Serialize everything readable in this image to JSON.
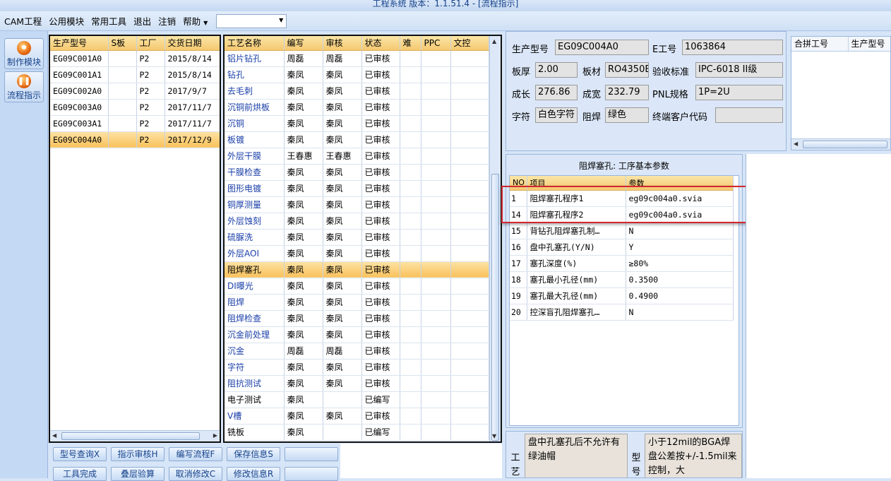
{
  "window": {
    "title": "工程系统  版本：1.1.51.4 - [流程指示]"
  },
  "menu": {
    "items": [
      "CAM工程",
      "公用模块",
      "常用工具",
      "退出",
      "注销",
      "帮助"
    ],
    "combo_value": ""
  },
  "nav": [
    {
      "label": "制作模块",
      "icon": "fire-icon"
    },
    {
      "label": "流程指示",
      "icon": "pause-icon"
    }
  ],
  "models": {
    "headers": [
      "生产型号",
      "S板",
      "工厂",
      "交货日期"
    ],
    "rows": [
      [
        "EG09C001A0",
        "",
        "P2",
        "2015/8/14"
      ],
      [
        "EG09C001A1",
        "",
        "P2",
        "2015/8/14"
      ],
      [
        "EG09C002A0",
        "",
        "P2",
        "2017/9/7"
      ],
      [
        "EG09C003A0",
        "",
        "P2",
        "2017/11/7"
      ],
      [
        "EG09C003A1",
        "",
        "P2",
        "2017/11/7"
      ],
      [
        "EG09C004A0",
        "",
        "P2",
        "2017/12/9"
      ]
    ],
    "selected_index": 5
  },
  "processes": {
    "headers": [
      "工艺名称",
      "编写",
      "审核",
      "状态",
      "难",
      "PPC",
      "文控"
    ],
    "rows": [
      [
        "铝片钻孔",
        "周磊",
        "周磊",
        "已审核"
      ],
      [
        "钻孔",
        "秦凤",
        "秦凤",
        "已审核"
      ],
      [
        "去毛刺",
        "秦凤",
        "秦凤",
        "已审核"
      ],
      [
        "沉铜前烘板",
        "秦凤",
        "秦凤",
        "已审核"
      ],
      [
        "沉铜",
        "秦凤",
        "秦凤",
        "已审核"
      ],
      [
        "板镀",
        "秦凤",
        "秦凤",
        "已审核"
      ],
      [
        "外层干膜",
        "王春惠",
        "王春惠",
        "已审核"
      ],
      [
        "干膜检查",
        "秦凤",
        "秦凤",
        "已审核"
      ],
      [
        "图形电镀",
        "秦凤",
        "秦凤",
        "已审核"
      ],
      [
        "铜厚测量",
        "秦凤",
        "秦凤",
        "已审核"
      ],
      [
        "外层蚀刻",
        "秦凤",
        "秦凤",
        "已审核"
      ],
      [
        "硫脲洗",
        "秦凤",
        "秦凤",
        "已审核"
      ],
      [
        "外层AOI",
        "秦凤",
        "秦凤",
        "已审核"
      ],
      [
        "阻焊塞孔",
        "秦凤",
        "秦凤",
        "已审核"
      ],
      [
        "DI曝光",
        "秦凤",
        "秦凤",
        "已审核"
      ],
      [
        "阻焊",
        "秦凤",
        "秦凤",
        "已审核"
      ],
      [
        "阻焊检查",
        "秦凤",
        "秦凤",
        "已审核"
      ],
      [
        "沉金前处理",
        "秦凤",
        "秦凤",
        "已审核"
      ],
      [
        "沉金",
        "周磊",
        "周磊",
        "已审核"
      ],
      [
        "字符",
        "秦凤",
        "秦凤",
        "已审核"
      ],
      [
        "阻抗测试",
        "秦凤",
        "秦凤",
        "已审核"
      ],
      [
        "电子测试",
        "秦凤",
        "",
        "已编写"
      ],
      [
        "V槽",
        "秦凤",
        "秦凤",
        "已审核"
      ],
      [
        "铣板",
        "秦凤",
        "",
        "已编写"
      ]
    ],
    "selected_index": 13,
    "blue_rows": [
      0,
      1,
      2,
      3,
      4,
      5,
      6,
      7,
      8,
      9,
      10,
      11,
      12,
      14,
      15,
      16,
      17,
      18,
      19,
      20,
      22
    ]
  },
  "buttons": [
    [
      "型号查询X",
      "指示审核H",
      "编写流程F",
      "保存信息S",
      ""
    ],
    [
      "工具完成",
      "叠层验算",
      "取消修改C",
      "修改信息R",
      ""
    ]
  ],
  "info": {
    "model_label": "生产型号",
    "model": "EG09C004A0",
    "eno_label": "E工号",
    "eno": "1063864",
    "thickness_label": "板厚",
    "thickness": "2.00",
    "material_label": "板材",
    "material": "RO4350B",
    "standard_label": "验收标准",
    "standard": "IPC-6018 II级",
    "length_label": "成长",
    "length": "276.86",
    "width_label": "成宽",
    "width": "232.79",
    "pnl_label": "PNL规格",
    "pnl": "1P=2U",
    "char_label": "字符",
    "char": "白色字符",
    "mask_label": "阻焊",
    "mask": "绿色",
    "customer_label": "终端客户代码",
    "customer": ""
  },
  "merge": {
    "headers": [
      "合拼工号",
      "生产型号"
    ]
  },
  "params": {
    "title": "阻焊塞孔: 工序基本参数",
    "headers": [
      "NO",
      "项目",
      "参数"
    ],
    "rows": [
      [
        "1",
        "阻焊塞孔程序1",
        "eg09c004a0.svia"
      ],
      [
        "14",
        "阻焊塞孔程序2",
        "eg09c004a0.svia"
      ],
      [
        "15",
        "背钻孔阻焊塞孔制…",
        "N"
      ],
      [
        "16",
        "盘中孔塞孔(Y/N)",
        "Y"
      ],
      [
        "17",
        "塞孔深度(%)",
        "≥80%"
      ],
      [
        "18",
        "塞孔最小孔径(mm)",
        "0.3500"
      ],
      [
        "19",
        "塞孔最大孔径(mm)",
        "0.4900"
      ],
      [
        "20",
        "控深盲孔阻焊塞孔…",
        "N"
      ]
    ]
  },
  "notes": {
    "left_label": "工艺",
    "left_text": "盘中孔塞孔后不允许有绿油帽",
    "right_label": "型号",
    "right_text": "小于12mil的BGA焊盘公差按+/-1.5mil来控制，大"
  }
}
